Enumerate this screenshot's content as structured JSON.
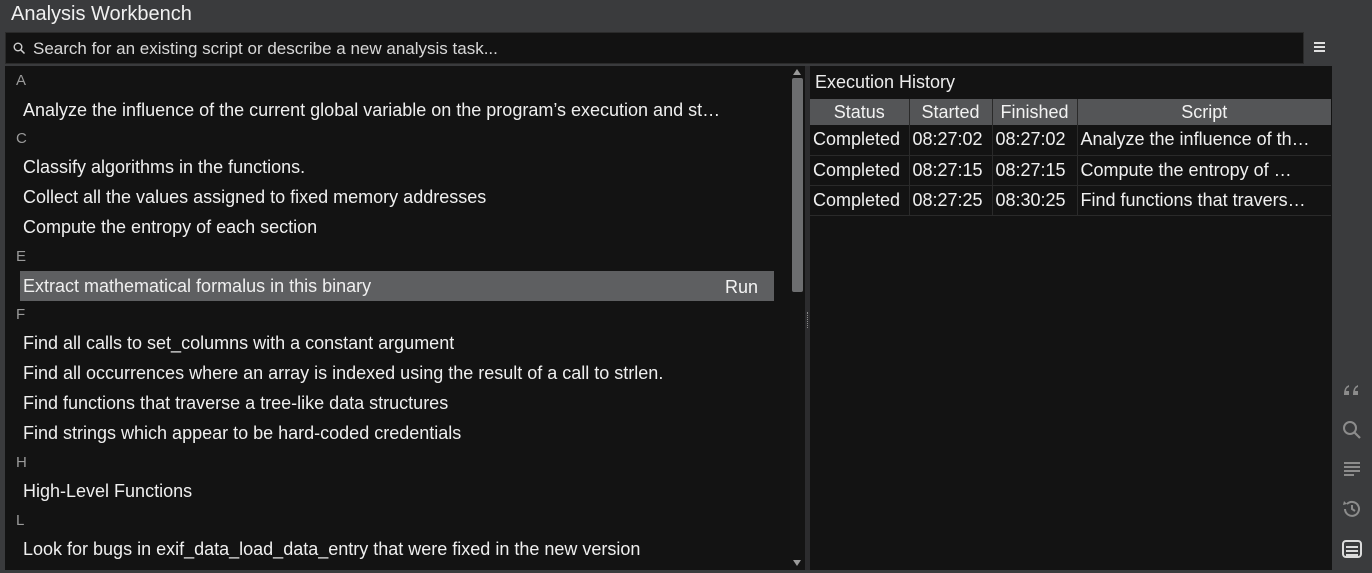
{
  "app": {
    "title": "Analysis Workbench"
  },
  "search": {
    "placeholder": "Search for an existing script or describe a new analysis task..."
  },
  "script_list": {
    "sections": [
      {
        "letter": "A",
        "items": [
          "Analyze the influence of the current global variable on the program’s execution and st…"
        ]
      },
      {
        "letter": "C",
        "items": [
          "Classify algorithms in the functions.",
          "Collect all the values assigned to fixed memory addresses",
          "Compute the entropy of each section"
        ]
      },
      {
        "letter": "E",
        "items": [
          "Extract mathematical formalus in this binary"
        ]
      },
      {
        "letter": "F",
        "items": [
          "Find all calls to set_columns with a constant argument",
          "Find all occurrences where an array is indexed using the result of a call to strlen.",
          "Find functions that traverse a tree-like data structures",
          "Find strings which appear to be hard-coded credentials"
        ]
      },
      {
        "letter": "H",
        "items": [
          "High-Level Functions"
        ]
      },
      {
        "letter": "L",
        "items": [
          "Look for bugs in exif_data_load_data_entry that were fixed in the new version"
        ]
      }
    ],
    "selected_item": "Extract mathematical formalus in this binary",
    "run_label": "Run"
  },
  "history": {
    "heading": "Execution History",
    "columns": [
      "Status",
      "Started",
      "Finished",
      "Script"
    ],
    "rows": [
      [
        "Completed",
        "08:27:02",
        "08:27:02",
        "Analyze the influence of th…"
      ],
      [
        "Completed",
        "08:27:15",
        "08:27:15",
        "Compute the entropy of …"
      ],
      [
        "Completed",
        "08:27:25",
        "08:30:25",
        "Find functions that travers…"
      ]
    ]
  },
  "toolbar": {
    "icons": [
      "quote-icon",
      "search-icon",
      "lines-icon",
      "history-icon",
      "workbench-icon"
    ]
  },
  "colors": {
    "background": "#3a3b3d",
    "panel": "#131313",
    "selection": "#5e5f61",
    "header": "#545557"
  }
}
